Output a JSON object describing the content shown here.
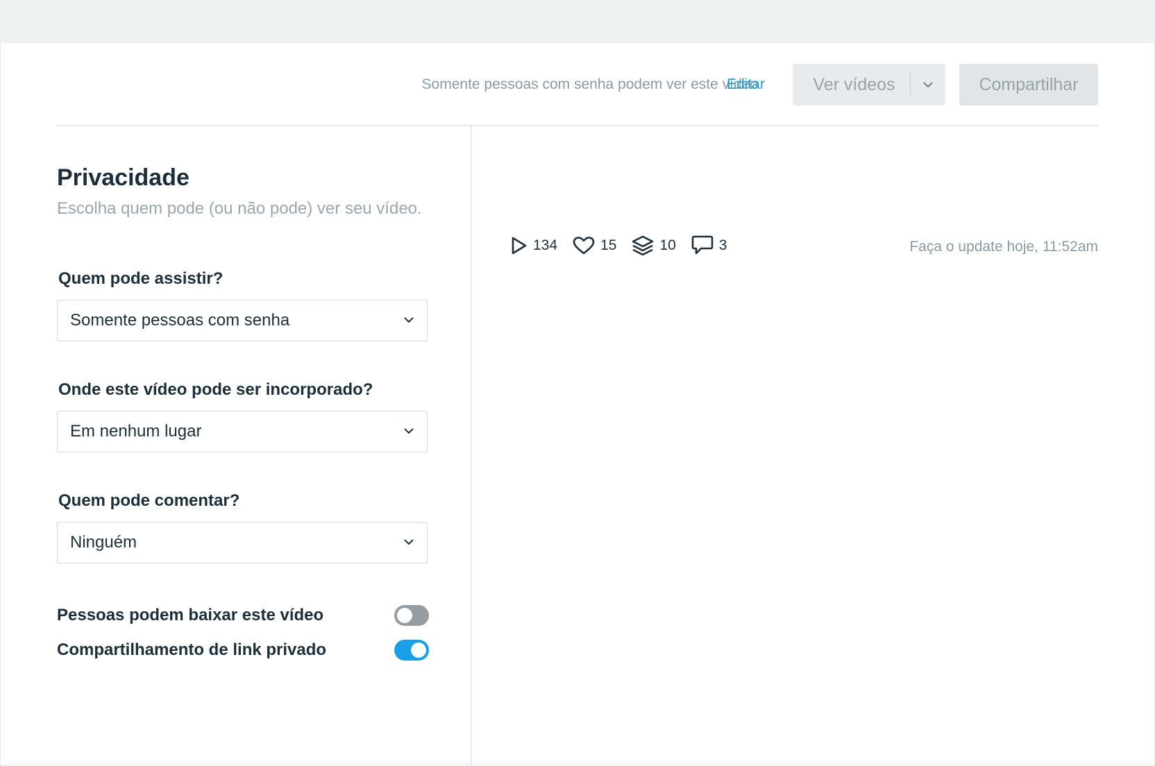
{
  "header": {
    "privacy_status": "Somente pessoas com senha podem ver este vídeo",
    "edit_label": "Editar",
    "view_videos_label": "Ver vídeos",
    "share_label": "Compartilhar"
  },
  "privacy": {
    "title": "Privacidade",
    "subtitle": "Escolha quem pode (ou não pode) ver seu vídeo.",
    "fields": [
      {
        "label": "Quem pode assistir?",
        "value": "Somente pessoas com senha"
      },
      {
        "label": "Onde este vídeo pode ser incorporado?",
        "value": "Em nenhum lugar"
      },
      {
        "label": "Quem pode comentar?",
        "value": "Ninguém"
      }
    ],
    "toggles": [
      {
        "label": "Pessoas podem baixar este vídeo",
        "on": false
      },
      {
        "label": "Compartilhamento de link privado",
        "on": true
      }
    ]
  },
  "stats": {
    "plays": "134",
    "likes": "15",
    "collections": "10",
    "comments": "3",
    "updated": "Faça o update hoje, 11:52am"
  },
  "colors": {
    "accent": "#17a0e8",
    "link": "#17a0d6",
    "toggle_off": "#959da2"
  }
}
